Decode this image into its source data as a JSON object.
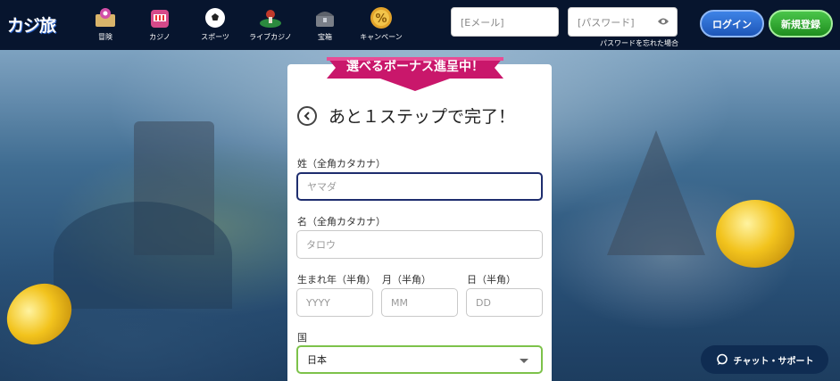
{
  "header": {
    "logo": "カジ旅",
    "nav": [
      {
        "label": "冒険",
        "icon": "map-icon"
      },
      {
        "label": "カジノ",
        "icon": "slot-machine-icon"
      },
      {
        "label": "スポーツ",
        "icon": "soccer-ball-icon"
      },
      {
        "label": "ライブカジノ",
        "icon": "roulette-icon"
      },
      {
        "label": "宝箱",
        "icon": "treasure-chest-icon"
      },
      {
        "label": "キャンペーン",
        "icon": "percent-coin-icon"
      }
    ],
    "email_placeholder": "[Eメール]",
    "password_placeholder": "[パスワード]",
    "forgot_password": "パスワードを忘れた場合",
    "login_label": "ログイン",
    "register_label": "新規登録"
  },
  "form": {
    "ribbon": "選べるボーナス進呈中！",
    "title": "あと１ステップで完了！",
    "last_name_label": "姓（全角カタカナ）",
    "last_name_placeholder": "ヤマダ",
    "first_name_label": "名（全角カタカナ）",
    "first_name_placeholder": "タロウ",
    "birth_year_label": "生まれ年（半角）",
    "birth_year_placeholder": "YYYY",
    "birth_month_label": "月（半角）",
    "birth_month_placeholder": "MM",
    "birth_day_label": "日（半角）",
    "birth_day_placeholder": "DD",
    "country_label": "国",
    "country_value": "日本"
  },
  "chat": {
    "label": "チャット・サポート"
  },
  "colors": {
    "header_bg": "#07152e",
    "login": "#2a6ad6",
    "register": "#2aa52a",
    "focus_border": "#1e2d6e",
    "select_border": "#7dc24a"
  }
}
